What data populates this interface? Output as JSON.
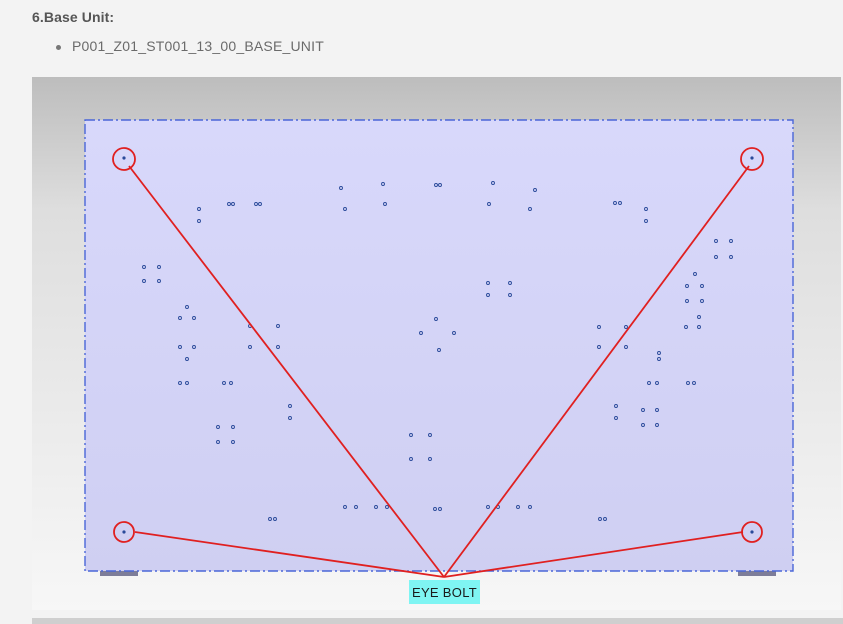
{
  "section": {
    "heading": "6.Base Unit:",
    "items": [
      "P001_Z01_ST001_13_00_BASE_UNIT"
    ]
  },
  "figure": {
    "callout_label": "EYE BOLT",
    "colors": {
      "background_top": "#bdbdbd",
      "plate_fill": "#d3d3fb",
      "plate_border": "#4a66d8",
      "callout_line": "#e02020",
      "callout_box": "#7ff5f3",
      "hole_marker": "#2a4a9a"
    }
  }
}
